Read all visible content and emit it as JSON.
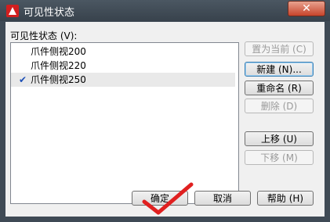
{
  "window": {
    "title": "可见性状态",
    "close_label": "✕"
  },
  "list": {
    "label": "可见性状态 (V):",
    "items": [
      {
        "label": "爪件侧视200",
        "checked": false
      },
      {
        "label": "爪件侧视220",
        "checked": false
      },
      {
        "label": "爪件侧视250",
        "checked": true
      }
    ],
    "check_glyph": "✔"
  },
  "buttons": {
    "set_current": "置为当前 (C)",
    "new": "新建 (N)...",
    "rename": "重命名 (R)",
    "delete": "删除 (D)",
    "move_up": "上移 (U)",
    "move_down": "下移 (M)",
    "ok": "确定",
    "cancel": "取消",
    "help": "帮助 (H)"
  },
  "colors": {
    "accent": "#1c4fb6",
    "close": "#c7442b"
  }
}
